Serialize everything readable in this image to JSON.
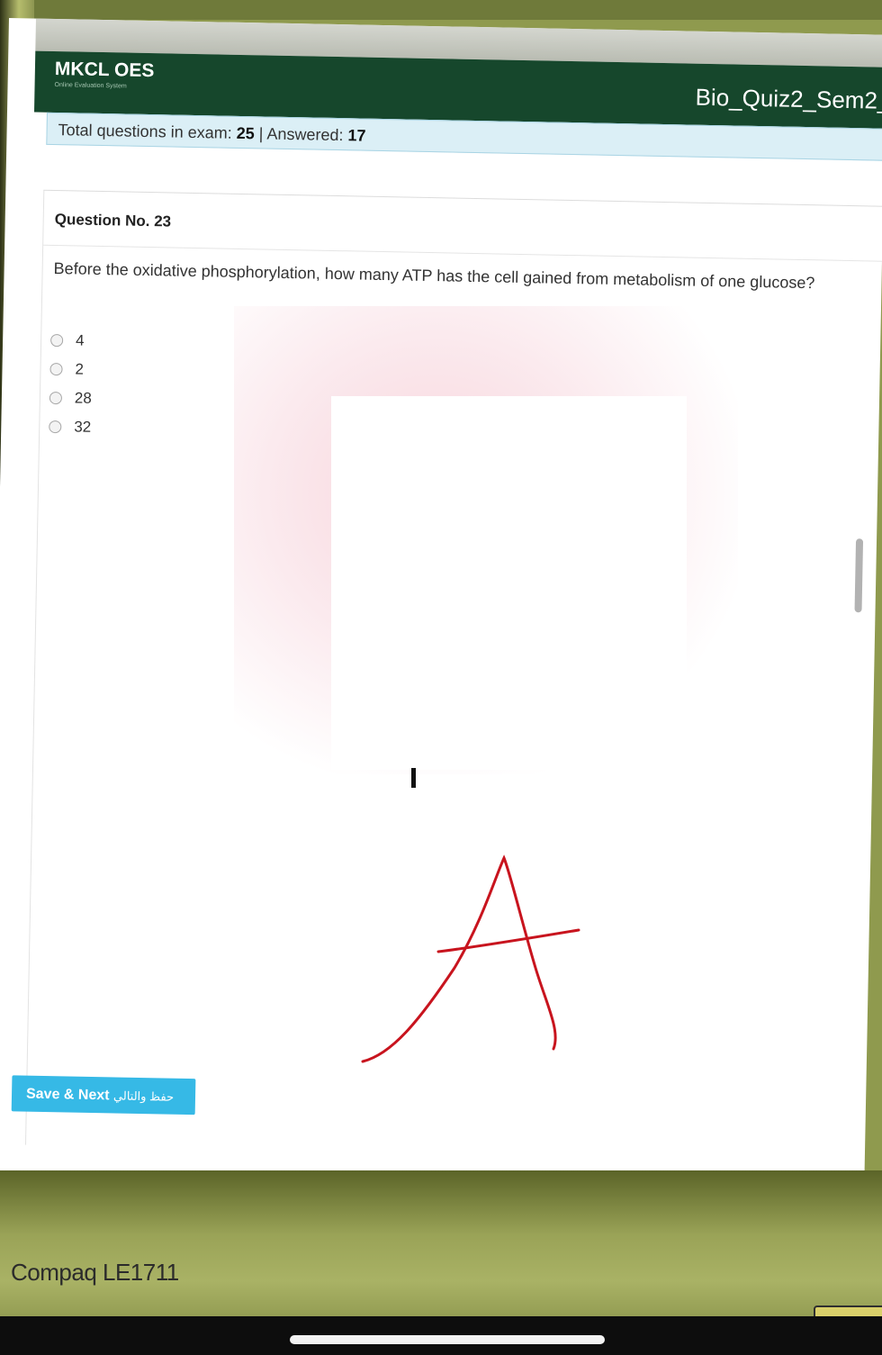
{
  "app": {
    "logo": "MKCL OES",
    "logo_subtitle": "Online Evaluation System",
    "exam_title": "Bio_Quiz2_Sem2_"
  },
  "status": {
    "total_label": "Total questions in exam:",
    "total_value": "25",
    "answered_label": "| Answered:",
    "answered_value": "17"
  },
  "question": {
    "number_label": "Question No. 23",
    "text": "Before the oxidative phosphorylation, how many ATP has the cell gained from metabolism of one glucose?",
    "options": [
      "4",
      "2",
      "28",
      "32"
    ]
  },
  "actions": {
    "save_next_label": "Save & Next",
    "save_next_arabic": "حفظ والتالي"
  },
  "annotation": {
    "handwritten_letter": "A",
    "ink_color": "#c8141e"
  },
  "device": {
    "monitor_brand": "Compaq LE1711"
  },
  "colors": {
    "header": "#16472c",
    "status_bar": "#dbeff6",
    "save_button": "#36b9e6"
  }
}
